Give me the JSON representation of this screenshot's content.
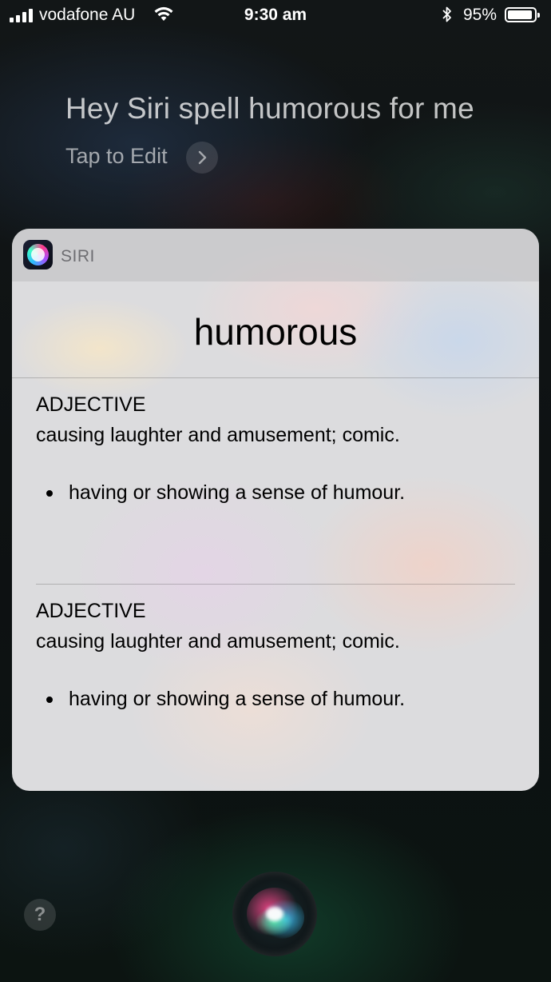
{
  "status_bar": {
    "carrier": "vodafone AU",
    "time": "9:30 am",
    "battery_percent": "95%",
    "battery_level": 0.95,
    "icons": [
      "signal-icon",
      "wifi-icon",
      "bluetooth-icon",
      "battery-icon"
    ]
  },
  "query": {
    "text": "Hey Siri spell humorous for me",
    "tap_to_edit": "Tap to Edit"
  },
  "card": {
    "app_label": "SIRI",
    "word": "humorous",
    "senses": [
      {
        "part_of_speech": "ADJECTIVE",
        "definition": "causing laughter and amusement; comic.",
        "bullet": "having or showing a sense of humour."
      },
      {
        "part_of_speech": "ADJECTIVE",
        "definition": "causing laughter and amusement; comic.",
        "bullet": "having or showing a sense of humour."
      }
    ]
  },
  "bottom": {
    "help_label": "?"
  },
  "colors": {
    "card_background": "#dcdcde",
    "text_primary": "#000000",
    "siri_label": "#6e6e72"
  }
}
